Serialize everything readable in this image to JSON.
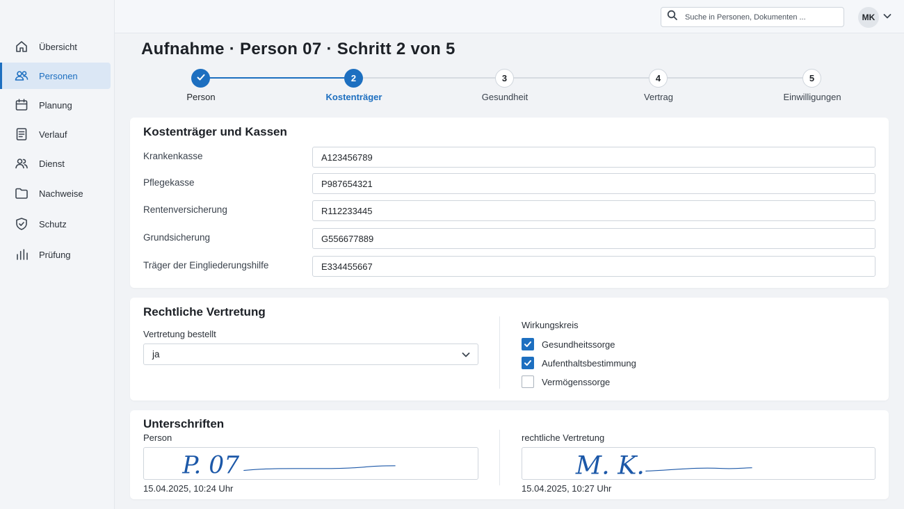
{
  "sidebar": {
    "items": [
      {
        "label": "Übersicht",
        "icon": "home-icon"
      },
      {
        "label": "Personen",
        "icon": "users-icon",
        "active": true
      },
      {
        "label": "Planung",
        "icon": "calendar-icon"
      },
      {
        "label": "Verlauf",
        "icon": "document-icon"
      },
      {
        "label": "Dienst",
        "icon": "team-icon"
      },
      {
        "label": "Nachweise",
        "icon": "folder-icon"
      },
      {
        "label": "Schutz",
        "icon": "shield-icon"
      },
      {
        "label": "Prüfung",
        "icon": "bar-chart-icon"
      }
    ]
  },
  "header": {
    "search_placeholder": "Suche in Personen, Dokumenten ...",
    "user_initials": "MK"
  },
  "page": {
    "title_part1": "Aufnahme",
    "title_part2": "Person 07",
    "title_part3": "Schritt 2 von 5",
    "separator": "·"
  },
  "stepper": {
    "accent_color": "#1d6fc0",
    "steps": [
      {
        "number": "1",
        "label": "Person",
        "state": "done"
      },
      {
        "number": "2",
        "label": "Kostenträger",
        "state": "current"
      },
      {
        "number": "3",
        "label": "Gesundheit",
        "state": "todo"
      },
      {
        "number": "4",
        "label": "Vertrag",
        "state": "todo"
      },
      {
        "number": "5",
        "label": "Einwilligungen",
        "state": "todo"
      }
    ]
  },
  "kostentraeger": {
    "title": "Kostenträger und Kassen",
    "fields": [
      {
        "label": "Krankenkasse",
        "value": "A123456789"
      },
      {
        "label": "Pflegekasse",
        "value": "P987654321"
      },
      {
        "label": "Rentenversicherung",
        "value": "R112233445"
      },
      {
        "label": "Grundsicherung",
        "value": "G556677889"
      },
      {
        "label": "Träger der Eingliederungshilfe",
        "value": "E334455667"
      }
    ]
  },
  "vertretung": {
    "title": "Rechtliche Vertretung",
    "select_label": "Vertretung bestellt",
    "select_value": "ja",
    "scope_label": "Wirkungskreis",
    "scopes": [
      {
        "label": "Gesundheitssorge",
        "checked": true
      },
      {
        "label": "Aufenthaltsbestimmung",
        "checked": true
      },
      {
        "label": "Vermögenssorge",
        "checked": false
      }
    ]
  },
  "unterschriften": {
    "title": "Unterschriften",
    "person": {
      "label": "Person",
      "signature_text": "P. 07",
      "timestamp": "15.04.2025, 10:24 Uhr"
    },
    "vertretung": {
      "label": "rechtliche Vertretung",
      "signature_text": "M. K.",
      "timestamp": "15.04.2025, 10:27 Uhr"
    }
  }
}
